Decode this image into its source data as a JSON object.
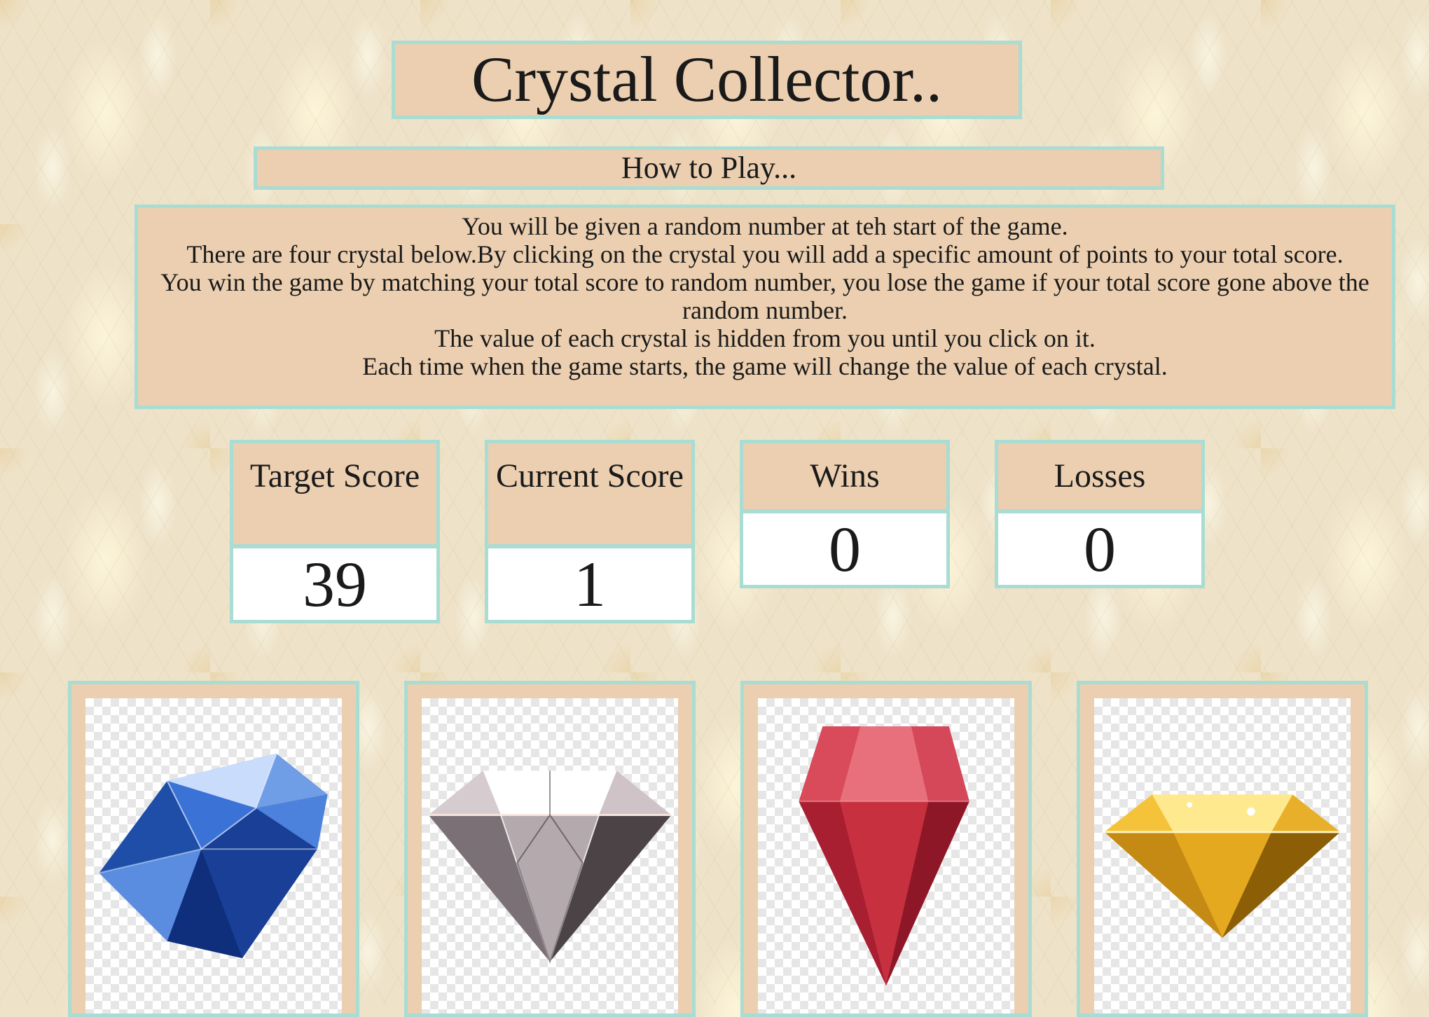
{
  "header": {
    "title": "Crystal Collector.."
  },
  "instructions": {
    "heading": "How to Play...",
    "lines": [
      "You will be given a random number at teh start of the game.",
      "There are four crystal below.By clicking on the crystal you will add a specific amount of points to your total score.",
      "You win the game by matching your total score to random number, you lose the game if your total score gone above the random number.",
      "The value of each crystal is hidden from you until you click on it.",
      "Each time when the game starts, the game will change the value of each crystal."
    ]
  },
  "stats": {
    "target": {
      "label": "Target Score",
      "value": "39"
    },
    "current": {
      "label": "Current Score",
      "value": "1"
    },
    "wins": {
      "label": "Wins",
      "value": "0"
    },
    "losses": {
      "label": "Losses",
      "value": "0"
    }
  },
  "crystals": [
    {
      "icon": "blue-diamond-icon"
    },
    {
      "icon": "clear-diamond-icon"
    },
    {
      "icon": "red-gem-icon"
    },
    {
      "icon": "gold-diamond-icon"
    }
  ],
  "colors": {
    "panel": "#ebcfb0",
    "border": "#a9ddd3",
    "background": "#eee2c8"
  }
}
